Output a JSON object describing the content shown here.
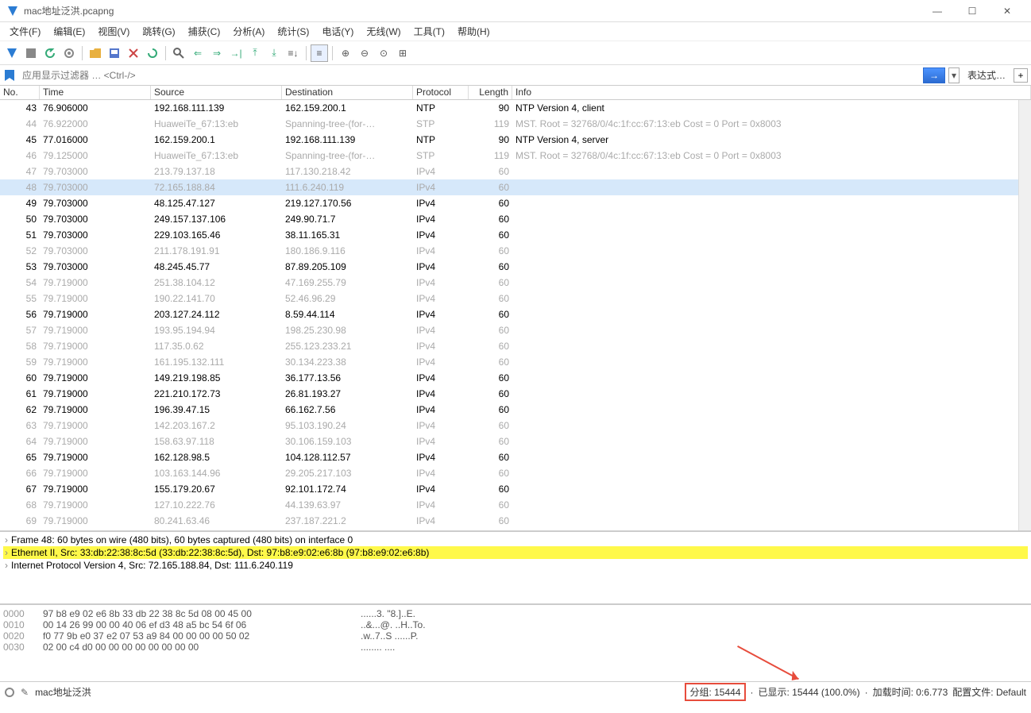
{
  "title": "mac地址泛洪.pcapng",
  "window_buttons": {
    "min": "—",
    "max": "☐",
    "close": "✕"
  },
  "menu": [
    "文件(F)",
    "编辑(E)",
    "视图(V)",
    "跳转(G)",
    "捕获(C)",
    "分析(A)",
    "统计(S)",
    "电话(Y)",
    "无线(W)",
    "工具(T)",
    "帮助(H)"
  ],
  "filter": {
    "placeholder": "应用显示过滤器 … <Ctrl-/>",
    "expr_label": "表达式…"
  },
  "columns": {
    "no": "No.",
    "time": "Time",
    "src": "Source",
    "dst": "Destination",
    "proto": "Protocol",
    "len": "Length",
    "info": "Info"
  },
  "packets": [
    {
      "no": "43",
      "time": "76.906000",
      "src": "192.168.111.139",
      "dst": "162.159.200.1",
      "proto": "NTP",
      "len": "90",
      "info": "NTP Version 4, client",
      "dim": false,
      "sel": false
    },
    {
      "no": "44",
      "time": "76.922000",
      "src": "HuaweiTe_67:13:eb",
      "dst": "Spanning-tree-(for-…",
      "proto": "STP",
      "len": "119",
      "info": "MST. Root = 32768/0/4c:1f:cc:67:13:eb  Cost = 0  Port = 0x8003",
      "dim": true,
      "sel": false
    },
    {
      "no": "45",
      "time": "77.016000",
      "src": "162.159.200.1",
      "dst": "192.168.111.139",
      "proto": "NTP",
      "len": "90",
      "info": "NTP Version 4, server",
      "dim": false,
      "sel": false
    },
    {
      "no": "46",
      "time": "79.125000",
      "src": "HuaweiTe_67:13:eb",
      "dst": "Spanning-tree-(for-…",
      "proto": "STP",
      "len": "119",
      "info": "MST. Root = 32768/0/4c:1f:cc:67:13:eb  Cost = 0  Port = 0x8003",
      "dim": true,
      "sel": false
    },
    {
      "no": "47",
      "time": "79.703000",
      "src": "213.79.137.18",
      "dst": "117.130.218.42",
      "proto": "IPv4",
      "len": "60",
      "info": "",
      "dim": true,
      "sel": false
    },
    {
      "no": "48",
      "time": "79.703000",
      "src": "72.165.188.84",
      "dst": "111.6.240.119",
      "proto": "IPv4",
      "len": "60",
      "info": "",
      "dim": true,
      "sel": true
    },
    {
      "no": "49",
      "time": "79.703000",
      "src": "48.125.47.127",
      "dst": "219.127.170.56",
      "proto": "IPv4",
      "len": "60",
      "info": "",
      "dim": false,
      "sel": false
    },
    {
      "no": "50",
      "time": "79.703000",
      "src": "249.157.137.106",
      "dst": "249.90.71.7",
      "proto": "IPv4",
      "len": "60",
      "info": "",
      "dim": false,
      "sel": false
    },
    {
      "no": "51",
      "time": "79.703000",
      "src": "229.103.165.46",
      "dst": "38.11.165.31",
      "proto": "IPv4",
      "len": "60",
      "info": "",
      "dim": false,
      "sel": false
    },
    {
      "no": "52",
      "time": "79.703000",
      "src": "211.178.191.91",
      "dst": "180.186.9.116",
      "proto": "IPv4",
      "len": "60",
      "info": "",
      "dim": true,
      "sel": false
    },
    {
      "no": "53",
      "time": "79.703000",
      "src": "48.245.45.77",
      "dst": "87.89.205.109",
      "proto": "IPv4",
      "len": "60",
      "info": "",
      "dim": false,
      "sel": false
    },
    {
      "no": "54",
      "time": "79.719000",
      "src": "251.38.104.12",
      "dst": "47.169.255.79",
      "proto": "IPv4",
      "len": "60",
      "info": "",
      "dim": true,
      "sel": false
    },
    {
      "no": "55",
      "time": "79.719000",
      "src": "190.22.141.70",
      "dst": "52.46.96.29",
      "proto": "IPv4",
      "len": "60",
      "info": "",
      "dim": true,
      "sel": false
    },
    {
      "no": "56",
      "time": "79.719000",
      "src": "203.127.24.112",
      "dst": "8.59.44.114",
      "proto": "IPv4",
      "len": "60",
      "info": "",
      "dim": false,
      "sel": false
    },
    {
      "no": "57",
      "time": "79.719000",
      "src": "193.95.194.94",
      "dst": "198.25.230.98",
      "proto": "IPv4",
      "len": "60",
      "info": "",
      "dim": true,
      "sel": false
    },
    {
      "no": "58",
      "time": "79.719000",
      "src": "117.35.0.62",
      "dst": "255.123.233.21",
      "proto": "IPv4",
      "len": "60",
      "info": "",
      "dim": true,
      "sel": false
    },
    {
      "no": "59",
      "time": "79.719000",
      "src": "161.195.132.111",
      "dst": "30.134.223.38",
      "proto": "IPv4",
      "len": "60",
      "info": "",
      "dim": true,
      "sel": false
    },
    {
      "no": "60",
      "time": "79.719000",
      "src": "149.219.198.85",
      "dst": "36.177.13.56",
      "proto": "IPv4",
      "len": "60",
      "info": "",
      "dim": false,
      "sel": false
    },
    {
      "no": "61",
      "time": "79.719000",
      "src": "221.210.172.73",
      "dst": "26.81.193.27",
      "proto": "IPv4",
      "len": "60",
      "info": "",
      "dim": false,
      "sel": false
    },
    {
      "no": "62",
      "time": "79.719000",
      "src": "196.39.47.15",
      "dst": "66.162.7.56",
      "proto": "IPv4",
      "len": "60",
      "info": "",
      "dim": false,
      "sel": false
    },
    {
      "no": "63",
      "time": "79.719000",
      "src": "142.203.167.2",
      "dst": "95.103.190.24",
      "proto": "IPv4",
      "len": "60",
      "info": "",
      "dim": true,
      "sel": false
    },
    {
      "no": "64",
      "time": "79.719000",
      "src": "158.63.97.118",
      "dst": "30.106.159.103",
      "proto": "IPv4",
      "len": "60",
      "info": "",
      "dim": true,
      "sel": false
    },
    {
      "no": "65",
      "time": "79.719000",
      "src": "162.128.98.5",
      "dst": "104.128.112.57",
      "proto": "IPv4",
      "len": "60",
      "info": "",
      "dim": false,
      "sel": false
    },
    {
      "no": "66",
      "time": "79.719000",
      "src": "103.163.144.96",
      "dst": "29.205.217.103",
      "proto": "IPv4",
      "len": "60",
      "info": "",
      "dim": true,
      "sel": false
    },
    {
      "no": "67",
      "time": "79.719000",
      "src": "155.179.20.67",
      "dst": "92.101.172.74",
      "proto": "IPv4",
      "len": "60",
      "info": "",
      "dim": false,
      "sel": false
    },
    {
      "no": "68",
      "time": "79.719000",
      "src": "127.10.222.76",
      "dst": "44.139.63.97",
      "proto": "IPv4",
      "len": "60",
      "info": "",
      "dim": true,
      "sel": false
    },
    {
      "no": "69",
      "time": "79.719000",
      "src": "80.241.63.46",
      "dst": "237.187.221.2",
      "proto": "IPv4",
      "len": "60",
      "info": "",
      "dim": true,
      "sel": false
    }
  ],
  "details": [
    {
      "text": "Frame 48: 60 bytes on wire (480 bits), 60 bytes captured (480 bits) on interface 0",
      "hl": false
    },
    {
      "text": "Ethernet II, Src: 33:db:22:38:8c:5d (33:db:22:38:8c:5d), Dst: 97:b8:e9:02:e6:8b (97:b8:e9:02:e6:8b)",
      "hl": true
    },
    {
      "text": "Internet Protocol Version 4, Src: 72.165.188.84, Dst: 111.6.240.119",
      "hl": false
    }
  ],
  "hex": [
    {
      "off": "0000",
      "bytes": "97 b8 e9 02 e6 8b 33 db  22 38 8c 5d 08 00 45 00",
      "ascii": "......3. \"8.]..E."
    },
    {
      "off": "0010",
      "bytes": "00 14 26 99 00 00 40 06  ef d3 48 a5 bc 54 6f 06",
      "ascii": "..&...@. ..H..To."
    },
    {
      "off": "0020",
      "bytes": "f0 77 9b e0 37 e2 07 53  a9 84 00 00 00 00 50 02",
      "ascii": ".w..7..S ......P."
    },
    {
      "off": "0030",
      "bytes": "02 00 c4 d0 00 00 00 00  00 00 00 00",
      "ascii": "........ ...."
    }
  ],
  "status": {
    "file": "mac地址泛洪",
    "group": "分组: 15444",
    "displayed": "已显示: 15444 (100.0%)",
    "load": "加载时间: 0:6.773",
    "profile": "配置文件: Default"
  }
}
